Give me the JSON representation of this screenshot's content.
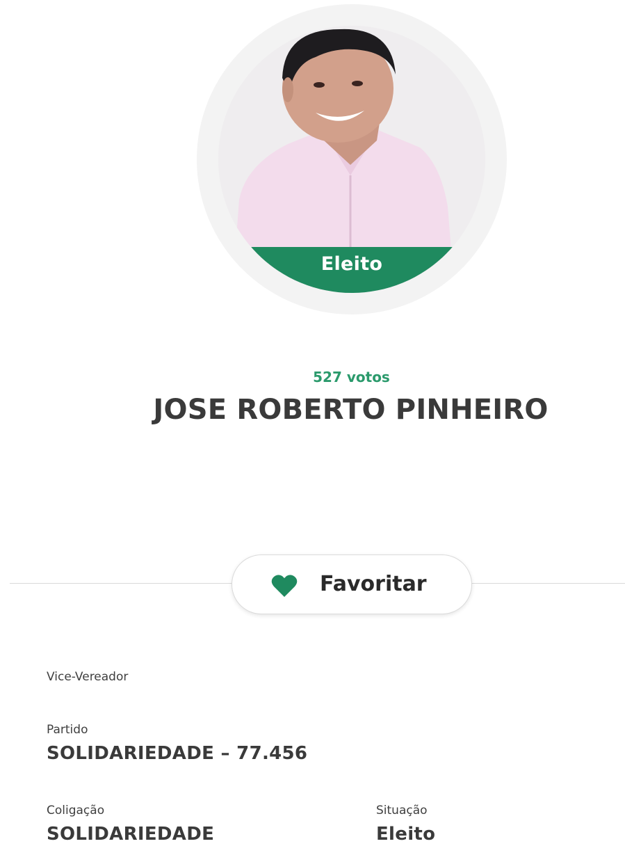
{
  "candidate": {
    "status_badge": "Eleito",
    "votes": "527 votos",
    "name": "JOSE ROBERTO PINHEIRO",
    "photo_icon": "candidate-portrait"
  },
  "actions": {
    "favorite_label": "Favoritar",
    "favorite_icon": "heart-icon"
  },
  "details": {
    "role": "Vice-Vereador",
    "party_label": "Partido",
    "party_value": "SOLIDARIEDADE – 77.456",
    "coalition_label": "Coligação",
    "coalition_value": "SOLIDARIEDADE",
    "situation_label": "Situação",
    "situation_value": "Eleito"
  },
  "colors": {
    "accent_green": "#1f8a5f",
    "votes_green": "#2b9a6c",
    "text_dark": "#3a3a3a",
    "divider": "#d9d9d9"
  }
}
